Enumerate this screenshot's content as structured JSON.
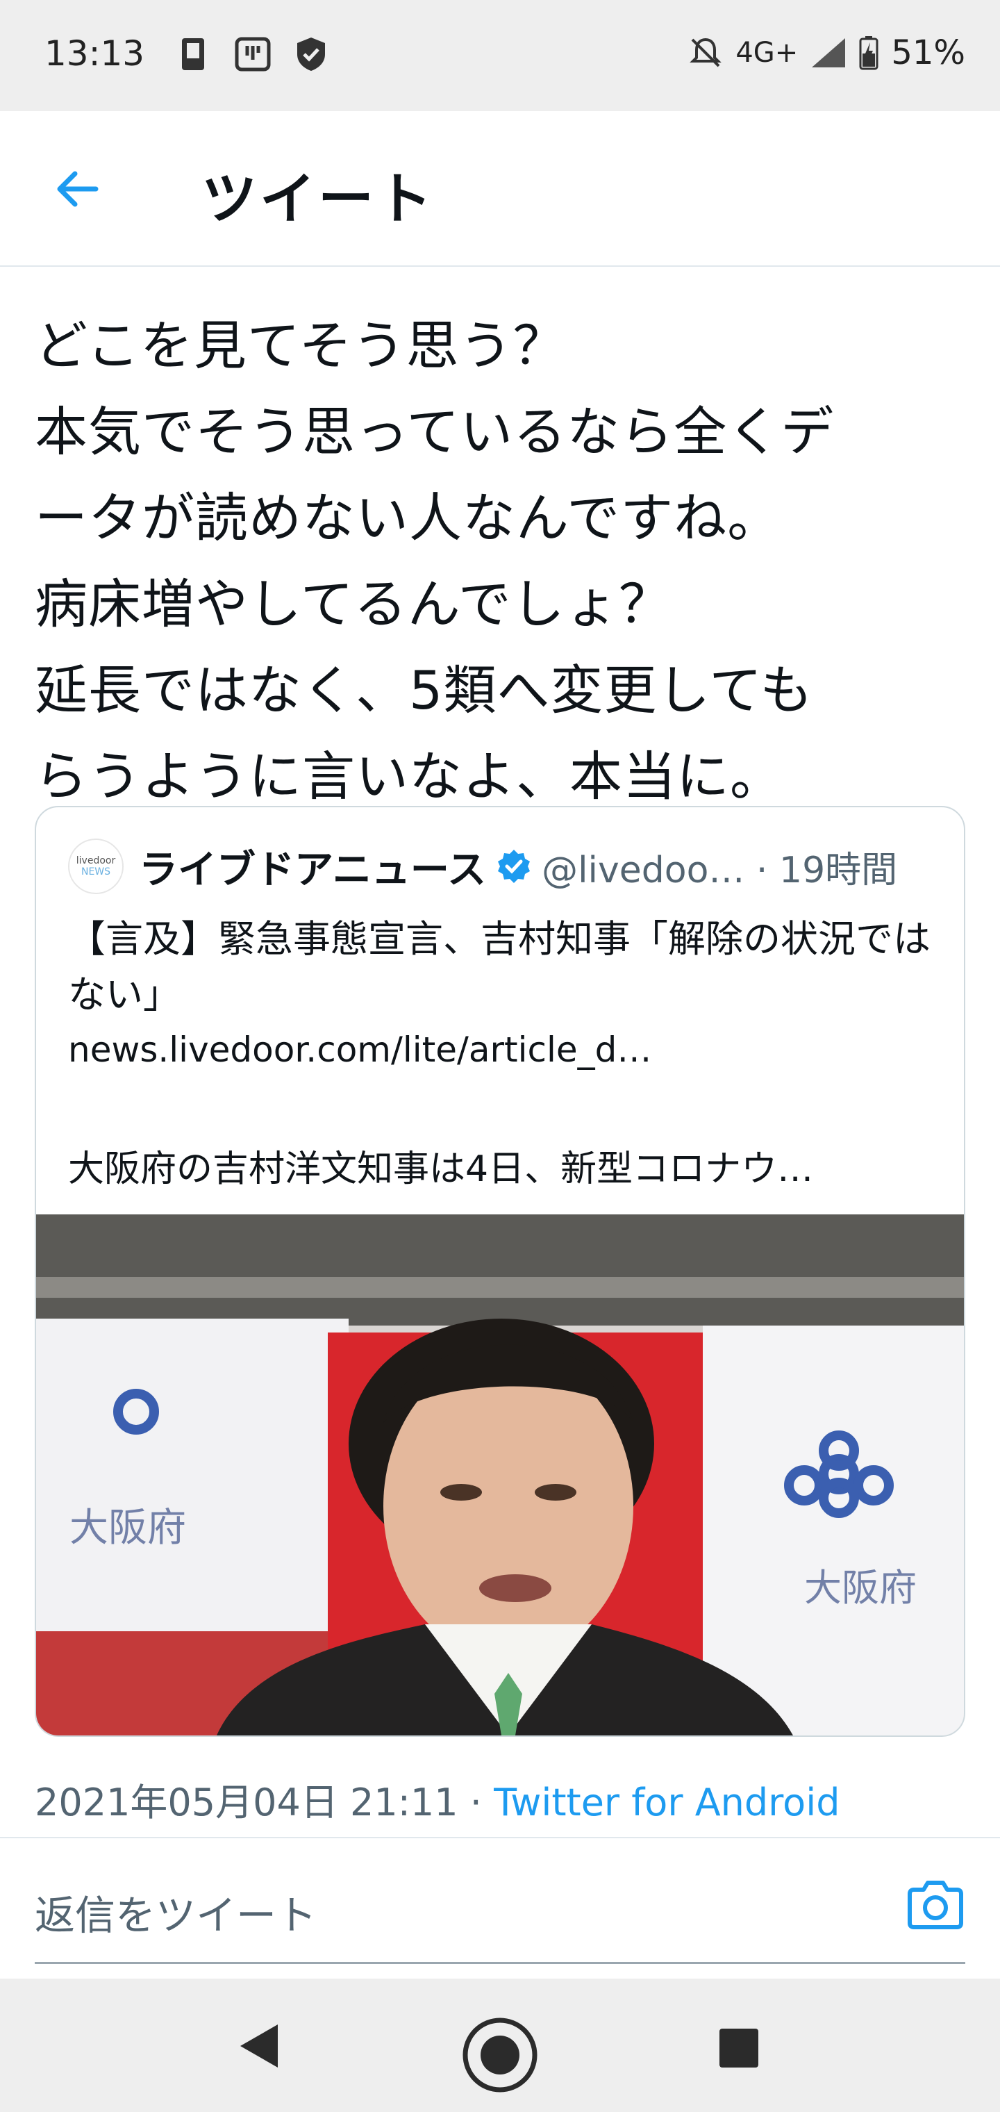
{
  "status_bar": {
    "time": "13:13",
    "network": "4G+",
    "battery": "51%",
    "icons": [
      "sim-icon",
      "voicemail-icon",
      "shield-icon",
      "mute-icon",
      "signal-icon",
      "battery-icon"
    ]
  },
  "header": {
    "title": "ツイート",
    "back_icon": "arrow-left-icon"
  },
  "tweet": {
    "text": "どこを見てそう思う？\n本気でそう思っているなら全くデ\nータが読めない人なんですね。\n病床増やしてるんでしょ？\n延長ではなく、5類へ変更しても\nらうように言いなよ、本当に。",
    "timestamp": "2021年05月04日 21:11 · ",
    "client": "Twitter for Android"
  },
  "quoted": {
    "avatar_line1": "livedoor",
    "avatar_line2": "NEWS",
    "name": "ライブドアニュース",
    "handle_time": "@livedoo… · 19時間",
    "title": "【言及】緊急事態宣言、吉村知事「解除の状況ではない」",
    "url": "news.livedoor.com/lite/article_d…",
    "description": "大阪府の吉村洋文知事は4日、新型コロナウ…",
    "image_signs": [
      "大阪府",
      "大阪府"
    ]
  },
  "reply": {
    "placeholder": "返信をツイート"
  },
  "colors": {
    "accent": "#1d9bf0",
    "text": "#0f1419",
    "secondary": "#536471",
    "bars": "#eeeeee"
  }
}
